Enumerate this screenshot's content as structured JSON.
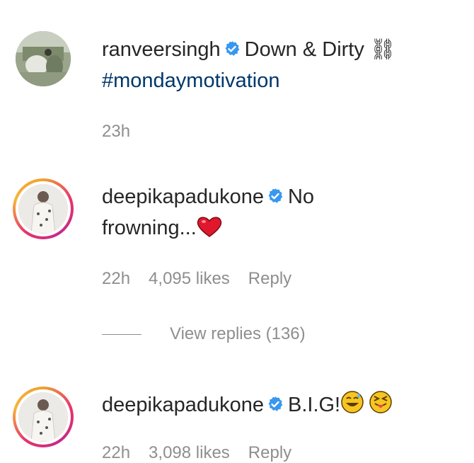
{
  "comments": [
    {
      "username": "ranveersingh",
      "text": "Down & Dirty ⛓",
      "hashtag": "#mondaymotivation",
      "time": "23h"
    },
    {
      "username": "deepikapadukone",
      "text_line1": "No",
      "text_line2": "frowning...",
      "emoji": "heart",
      "time": "22h",
      "likes": "4,095 likes",
      "reply": "Reply",
      "view_replies": "View replies (136)"
    },
    {
      "username": "deepikapadukone",
      "text": "B.I.G!",
      "emojis": [
        "sweat-smile-emoji",
        "squinting-tongue-emoji"
      ],
      "time": "22h",
      "likes": "3,098 likes",
      "reply": "Reply"
    }
  ],
  "colors": {
    "verified_blue": "#3897f0",
    "hashtag": "#00376b",
    "meta_gray": "#8e8e8e",
    "heart_red": "#e0182d"
  }
}
